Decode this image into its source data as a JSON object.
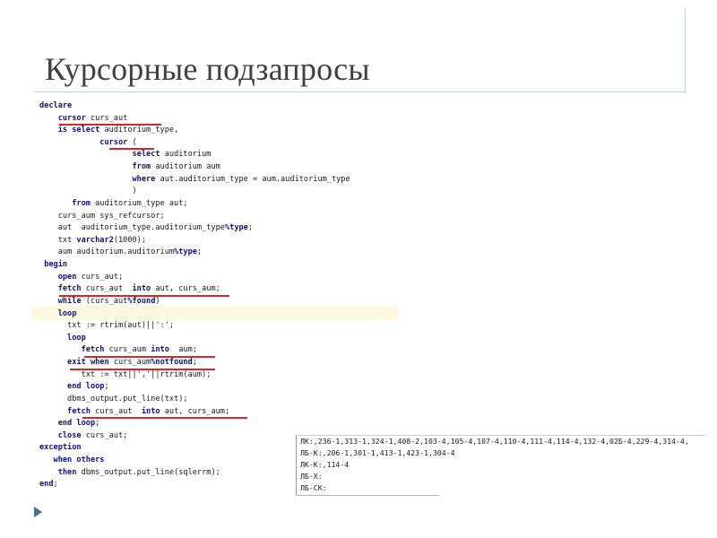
{
  "slide": {
    "title": "Курсорные подзапросы"
  },
  "code_lines": [
    "declare",
    "    cursor curs_aut",
    "    is select auditorium_type,",
    "             cursor (",
    "                    select auditorium",
    "                    from auditorium aum",
    "                    where aut.auditorium_type = aum.auditorium_type",
    "                    )",
    "       from auditorium_type aut;",
    "    curs_aum sys_refcursor;",
    "    aut  auditorium_type.auditorium_type%type;",
    "    txt varchar2(1000);",
    "    aum auditorium.auditorium%type;",
    " begin",
    "    open curs_aut;",
    "    fetch curs_aut  into aut, curs_aum;",
    "    while (curs_aut%found)",
    "    loop",
    "      txt := rtrim(aut)||':';",
    "      loop",
    "         fetch curs_aum into  aum;",
    "      exit when curs_aum%notfound;",
    "         txt := txt||','||rtrim(aum);",
    "      end loop;",
    "      dbms_output.put_line(txt);",
    "      fetch curs_aut  into aut, curs_aum;",
    "    end loop;",
    "    close curs_aut;",
    "exception",
    "   when others",
    "    then dbms_output.put_line(sqlerrm);",
    "end;"
  ],
  "output_lines": [
    "ЛК:,236-1,313-1,324-1,408-2,103-4,105-4,107-4,110-4,111-4,114-4,132-4,02Б-4,229-4,314-4,",
    "ЛБ-К:,206-1,301-1,413-1,423-1,304-4",
    "ЛК-К:,114-4",
    "ЛБ-Х:",
    "ЛБ-СК:"
  ],
  "colors": {
    "keyword": "#0e0e8c",
    "underline": "#d8262b",
    "highlight": "#fbfae0"
  }
}
